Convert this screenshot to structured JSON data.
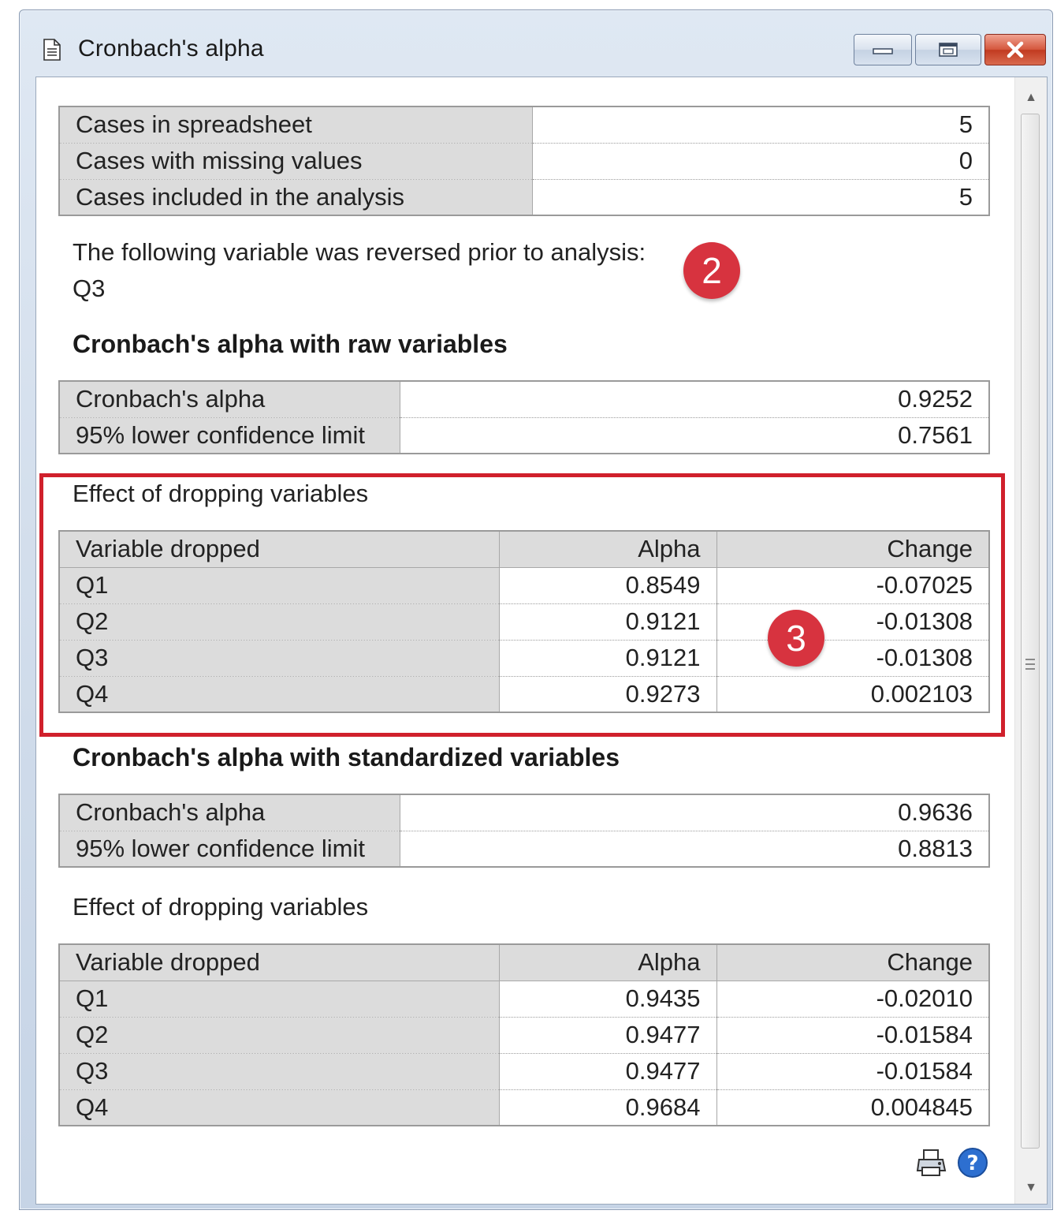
{
  "window": {
    "title": "Cronbach's alpha"
  },
  "summary": {
    "rows": [
      {
        "label": "Cases in spreadsheet",
        "value": "5"
      },
      {
        "label": "Cases with missing values",
        "value": "0"
      },
      {
        "label": "Cases included in the analysis",
        "value": "5"
      }
    ]
  },
  "reversed": {
    "text": "The following variable was reversed prior to analysis:",
    "variable": "Q3",
    "badge": "2"
  },
  "raw": {
    "heading": "Cronbach's alpha with raw variables",
    "stats": [
      {
        "label": "Cronbach's alpha",
        "value": "0.9252"
      },
      {
        "label": "95% lower confidence limit",
        "value": "0.7561"
      }
    ],
    "drop_title": "Effect of dropping variables",
    "drop_headers": [
      "Variable dropped",
      "Alpha",
      "Change"
    ],
    "drop_rows": [
      [
        "Q1",
        "0.8549",
        "-0.07025"
      ],
      [
        "Q2",
        "0.9121",
        "-0.01308"
      ],
      [
        "Q3",
        "0.9121",
        "-0.01308"
      ],
      [
        "Q4",
        "0.9273",
        "0.002103"
      ]
    ],
    "badge": "3"
  },
  "standardized": {
    "heading": "Cronbach's alpha with standardized variables",
    "stats": [
      {
        "label": "Cronbach's alpha",
        "value": "0.9636"
      },
      {
        "label": "95% lower confidence limit",
        "value": "0.8813"
      }
    ],
    "drop_title": "Effect of dropping variables",
    "drop_headers": [
      "Variable dropped",
      "Alpha",
      "Change"
    ],
    "drop_rows": [
      [
        "Q1",
        "0.9435",
        "-0.02010"
      ],
      [
        "Q2",
        "0.9477",
        "-0.01584"
      ],
      [
        "Q3",
        "0.9477",
        "-0.01584"
      ],
      [
        "Q4",
        "0.9684",
        "0.004845"
      ]
    ]
  },
  "colors": {
    "highlight": "#d0202c",
    "badge": "#d7333f",
    "label_cell": "#dcdcdc"
  },
  "icons": [
    "document-icon",
    "minimize-icon",
    "maximize-icon",
    "close-icon",
    "print-icon",
    "help-icon",
    "scroll-up-icon",
    "scroll-down-icon"
  ]
}
